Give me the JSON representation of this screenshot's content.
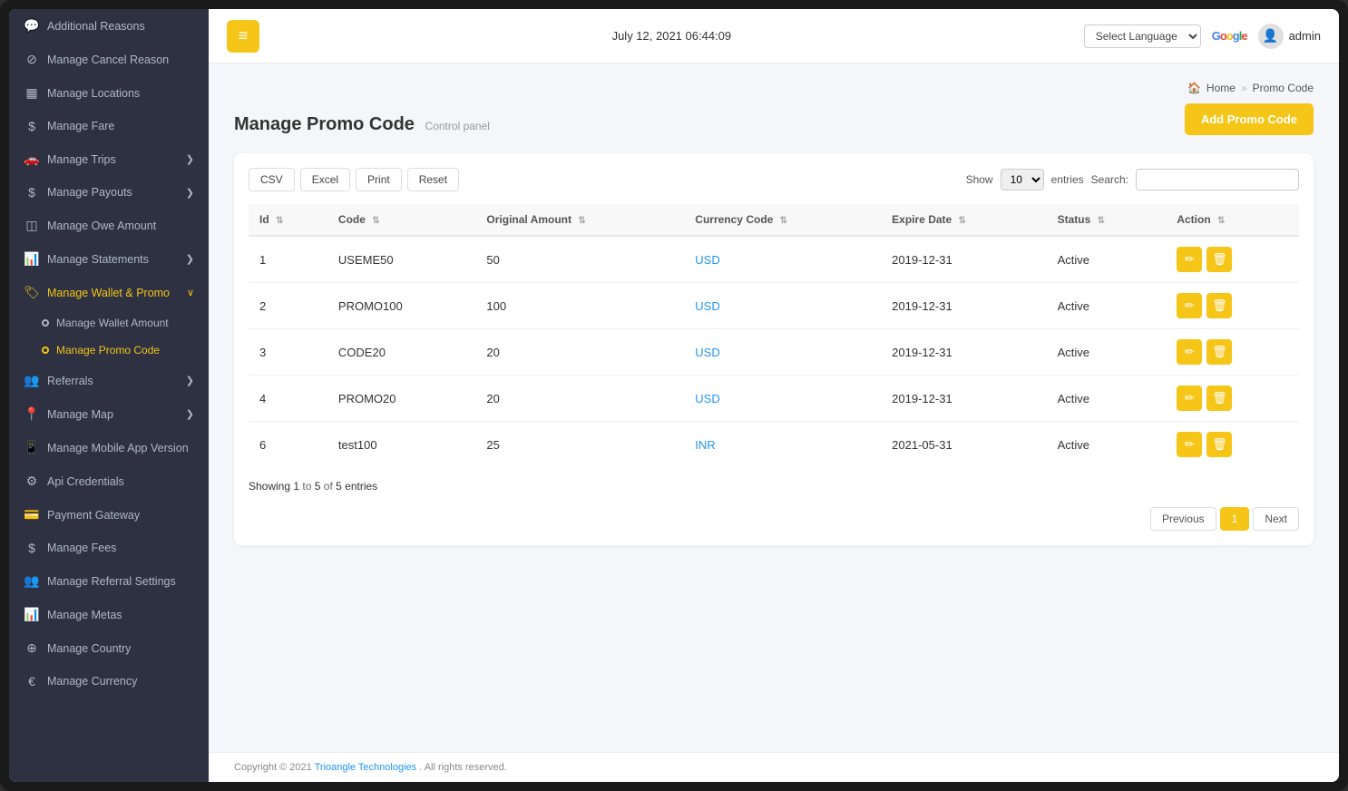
{
  "sidebar": {
    "items": [
      {
        "id": "additional-reasons",
        "label": "Additional Reasons",
        "icon": "💬",
        "active": false
      },
      {
        "id": "manage-cancel-reason",
        "label": "Manage Cancel Reason",
        "icon": "⊘",
        "active": false
      },
      {
        "id": "manage-locations",
        "label": "Manage Locations",
        "icon": "▦",
        "active": false
      },
      {
        "id": "manage-fare",
        "label": "Manage Fare",
        "icon": "$",
        "active": false
      },
      {
        "id": "manage-trips",
        "label": "Manage Trips",
        "icon": "🚗",
        "active": false,
        "hasChevron": true
      },
      {
        "id": "manage-payouts",
        "label": "Manage Payouts",
        "icon": "$",
        "active": false,
        "hasChevron": true
      },
      {
        "id": "manage-owe-amount",
        "label": "Manage Owe Amount",
        "icon": "◫",
        "active": false
      },
      {
        "id": "manage-statements",
        "label": "Manage Statements",
        "icon": "📊",
        "active": false,
        "hasChevron": true
      },
      {
        "id": "manage-wallet-promo",
        "label": "Manage Wallet & Promo",
        "icon": "🏷",
        "active": true,
        "hasChevron": true
      },
      {
        "id": "referrals",
        "label": "Referrals",
        "icon": "👥",
        "active": false,
        "hasChevron": true
      },
      {
        "id": "manage-map",
        "label": "Manage Map",
        "icon": "📍",
        "active": false,
        "hasChevron": true
      },
      {
        "id": "manage-mobile-app-version",
        "label": "Manage Mobile App Version",
        "icon": "📱",
        "active": false
      },
      {
        "id": "api-credentials",
        "label": "Api Credentials",
        "icon": "⚙",
        "active": false
      },
      {
        "id": "payment-gateway",
        "label": "Payment Gateway",
        "icon": "💳",
        "active": false
      },
      {
        "id": "manage-fees",
        "label": "Manage Fees",
        "icon": "$",
        "active": false
      },
      {
        "id": "manage-referral-settings",
        "label": "Manage Referral Settings",
        "icon": "👥",
        "active": false
      },
      {
        "id": "manage-metas",
        "label": "Manage Metas",
        "icon": "📊",
        "active": false
      },
      {
        "id": "manage-country",
        "label": "Manage Country",
        "icon": "⊕",
        "active": false
      },
      {
        "id": "manage-currency",
        "label": "Manage Currency",
        "icon": "€",
        "active": false
      }
    ],
    "sub_items": [
      {
        "id": "manage-wallet-amount",
        "label": "Manage Wallet Amount",
        "active": false
      },
      {
        "id": "manage-promo-code",
        "label": "Manage Promo Code",
        "active": true
      }
    ]
  },
  "topbar": {
    "datetime": "July 12, 2021 06:44:09",
    "language_placeholder": "Select Language",
    "admin_label": "admin",
    "menu_icon": "≡"
  },
  "breadcrumb": {
    "home_label": "Home",
    "separator": "»",
    "current": "Promo Code",
    "home_icon": "🏠"
  },
  "page": {
    "title": "Manage Promo Code",
    "subtitle": "Control panel",
    "add_button": "Add Promo Code"
  },
  "toolbar": {
    "csv_label": "CSV",
    "excel_label": "Excel",
    "print_label": "Print",
    "reset_label": "Reset",
    "show_label": "Show",
    "entries_label": "entries",
    "search_label": "Search:",
    "entries_value": "10"
  },
  "table": {
    "columns": [
      {
        "id": "id",
        "label": "Id"
      },
      {
        "id": "code",
        "label": "Code"
      },
      {
        "id": "original_amount",
        "label": "Original Amount"
      },
      {
        "id": "currency_code",
        "label": "Currency Code"
      },
      {
        "id": "expire_date",
        "label": "Expire Date"
      },
      {
        "id": "status",
        "label": "Status"
      },
      {
        "id": "action",
        "label": "Action"
      }
    ],
    "rows": [
      {
        "id": "1",
        "code": "USEME50",
        "original_amount": "50",
        "currency_code": "USD",
        "expire_date": "2019-12-31",
        "status": "Active"
      },
      {
        "id": "2",
        "code": "PROMO100",
        "original_amount": "100",
        "currency_code": "USD",
        "expire_date": "2019-12-31",
        "status": "Active"
      },
      {
        "id": "3",
        "code": "CODE20",
        "original_amount": "20",
        "currency_code": "USD",
        "expire_date": "2019-12-31",
        "status": "Active"
      },
      {
        "id": "4",
        "code": "PROMO20",
        "original_amount": "20",
        "currency_code": "USD",
        "expire_date": "2019-12-31",
        "status": "Active"
      },
      {
        "id": "6",
        "code": "test100",
        "original_amount": "25",
        "currency_code": "INR",
        "expire_date": "2021-05-31",
        "status": "Active"
      }
    ]
  },
  "pagination": {
    "showing_prefix": "Showing",
    "showing_from": "1",
    "showing_to": "5",
    "showing_total": "5",
    "showing_suffix": "entries",
    "previous_label": "Previous",
    "next_label": "Next",
    "current_page": "1"
  },
  "footer": {
    "text": "Copyright © 2021",
    "company": "Trioangle Technologies",
    "suffix": ". All rights reserved."
  }
}
